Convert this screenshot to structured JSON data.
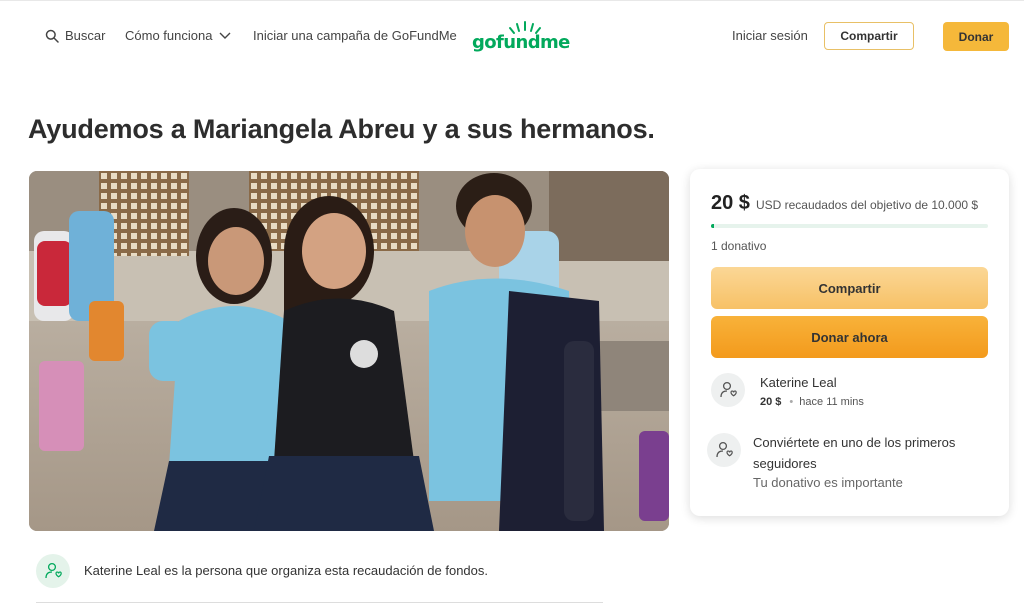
{
  "header": {
    "search_label": "Buscar",
    "how_it_works_label": "Cómo funciona",
    "start_campaign_label": "Iniciar una campaña de GoFundMe",
    "logo_text": "gofundme",
    "sign_in_label": "Iniciar sesión",
    "share_label": "Compartir",
    "donate_label": "Donar"
  },
  "campaign": {
    "title": "Ayudemos a Mariangela Abreu y a sus hermanos."
  },
  "donation_card": {
    "amount_raised": "20 $",
    "goal_text": "USD recaudados del objetivo de 10.000 $",
    "progress_fraction": 0.002,
    "donation_count": "1 donativo",
    "share_button": "Compartir",
    "donate_button": "Donar ahora",
    "recent_donor": {
      "name": "Katerine Leal",
      "amount": "20 $",
      "time": "hace 11 mins"
    },
    "cta_title": "Conviértete en uno de los primeros seguidores",
    "cta_subtitle": "Tu donativo es importante"
  },
  "organizer": {
    "text": "Katerine Leal es la persona que organiza esta recaudación de fondos."
  },
  "colors": {
    "brand_green": "#02a95c",
    "donate_orange": "#f39a1c",
    "share_yellow": "#f7c166"
  }
}
